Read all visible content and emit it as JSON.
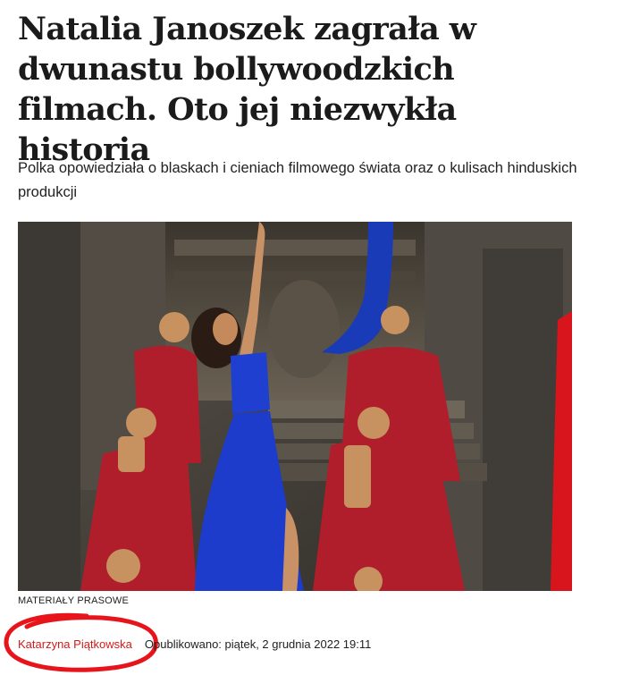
{
  "article": {
    "headline": "Natalia Janoszek zagrała w dwunastu bollywoodzkich filmach. Oto jej niezwykła historia",
    "lead": "Polka opowiedziała o blaskach i cieniach filmowego świata oraz o kulisach hinduskich produkcji",
    "photo_credit": "MATERIAŁY PRASOWE",
    "author": "Katarzyna Piątkowska",
    "published": "Opublikowano: piątek, 2 grudnia 2022 19:11"
  },
  "colors": {
    "author_link": "#d21a1a",
    "annotation_circle": "#e8141c"
  },
  "icons": {
    "annotation": "hand-drawn-red-circle"
  }
}
